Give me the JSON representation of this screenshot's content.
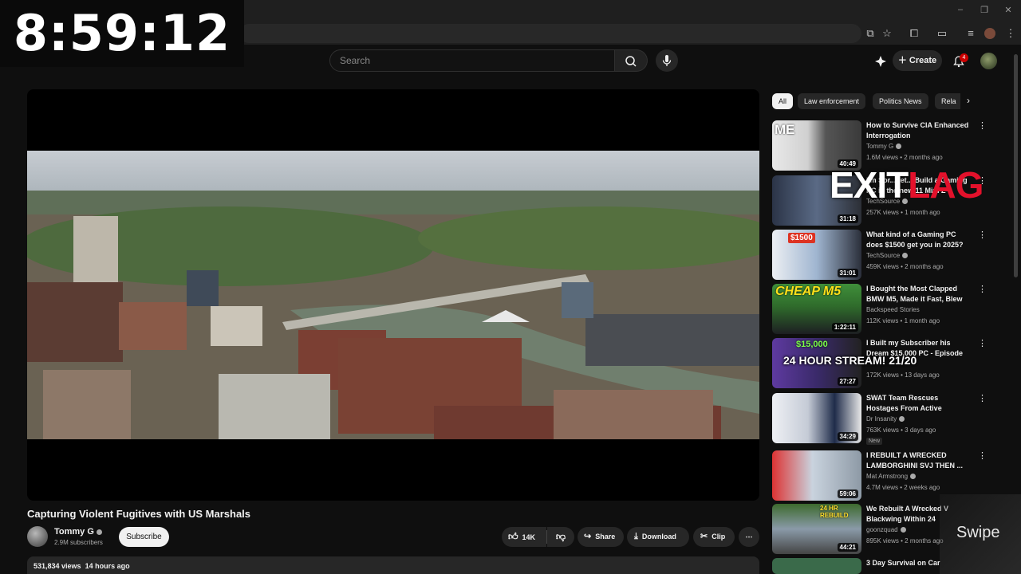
{
  "clock": "8:59:12",
  "masthead": {
    "search_placeholder": "Search",
    "create_label": "Create",
    "notifications_count": "4"
  },
  "video": {
    "title": "Capturing Violent Fugitives with US Marshals",
    "channel": "Tommy G",
    "subscribers": "2.9M subscribers",
    "subscribe_label": "Subscribe",
    "likes": "14K",
    "share_label": "Share",
    "download_label": "Download",
    "clip_label": "Clip",
    "views": "531,834 views",
    "age": "14 hours ago"
  },
  "chips": [
    "All",
    "Law enforcement",
    "Politics News",
    "Rela"
  ],
  "recommendations": [
    {
      "title": "How to Survive CIA Enhanced Interrogation",
      "channel": "Tommy G",
      "meta": "1.6M views • 2 months ago",
      "duration": "40:49",
      "thumb": "#3b3b3b",
      "new": ""
    },
    {
      "title": "I'm Sor...Let... Build a Gaming PC in the new 11 Mini Z",
      "channel": "TechSource",
      "meta": "257K views • 1 month ago",
      "duration": "31:18",
      "thumb": "#3a4a62",
      "new": ""
    },
    {
      "title": "What kind of a Gaming PC does $1500 get you in 2025?",
      "channel": "TechSource",
      "meta": "459K views • 2 months ago",
      "duration": "31:01",
      "thumb": "#4f6f9a",
      "new": ""
    },
    {
      "title": "I Bought the Most Clapped BMW M5, Made it Fast, Blew it...",
      "channel": "Backspeed Stories",
      "meta": "112K views • 1 month ago",
      "duration": "1:22:11",
      "thumb": "#2f6b2b",
      "new": ""
    },
    {
      "title": "I Built my Subscriber his Dream $15,000 PC - Episode 11",
      "channel": "",
      "meta": "172K views • 13 days ago",
      "duration": "27:27",
      "thumb": "#4b3a7a",
      "new": ""
    },
    {
      "title": "SWAT Team Rescues Hostages From Active Shooter",
      "channel": "Dr Insanity",
      "meta": "763K views • 3 days ago",
      "duration": "34:29",
      "thumb": "#2d3344",
      "new": "New"
    },
    {
      "title": "I REBUILT A WRECKED LAMBORGHINI SVJ THEN ...",
      "channel": "Mat Armstrong",
      "meta": "4.7M views • 2 weeks ago",
      "duration": "59:06",
      "thumb": "#6c7c8c",
      "new": ""
    },
    {
      "title": "We Rebuilt A Wrecked V Blackwing Within 24",
      "channel": "goonzquad",
      "meta": "895K views • 2 months ago",
      "duration": "44:21",
      "thumb": "#4a5a3a",
      "new": ""
    },
    {
      "title": "3 Day Survival on Car",
      "channel": "",
      "meta": "",
      "duration": "",
      "thumb": "#3a6a4a",
      "new": ""
    }
  ],
  "overlays": {
    "exitlag_left": "EXIT",
    "exitlag_right": "LAG",
    "stream_banner": "24 HOUR STREAM! 21/20",
    "swipe": "Swipe",
    "thumb_me": "ME",
    "thumb_cheap": "CHEAP M5",
    "thumb_1500": "$1500",
    "thumb_15000": "$15,000",
    "thumb_24hr": "24 HR REBUILD"
  },
  "colors": {
    "background": "#0f0f0f",
    "chip_bg": "#272727",
    "accent_red": "#cc0000"
  }
}
